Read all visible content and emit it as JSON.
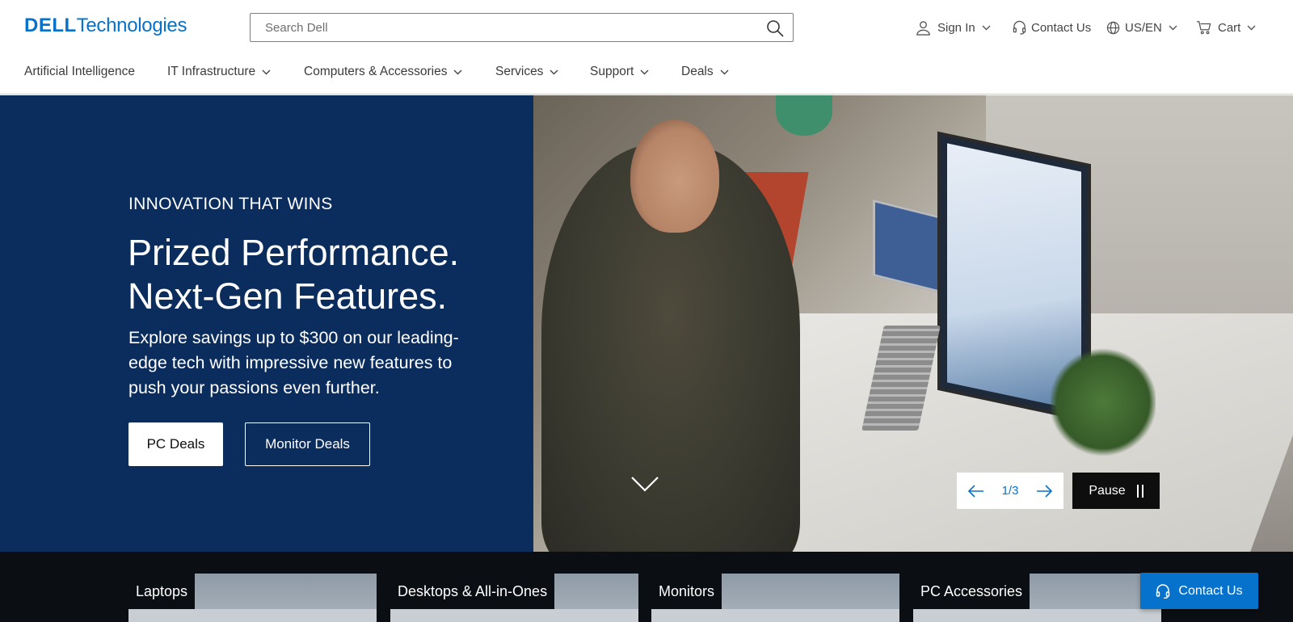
{
  "header": {
    "logo": {
      "brand": "DELL",
      "suffix": "Technologies"
    },
    "search": {
      "placeholder": "Search Dell",
      "value": ""
    },
    "utility": {
      "sign_in": "Sign In",
      "contact": "Contact Us",
      "locale": "US/EN",
      "cart": "Cart"
    },
    "nav": [
      {
        "label": "Artificial Intelligence",
        "has_menu": false
      },
      {
        "label": "IT Infrastructure",
        "has_menu": true
      },
      {
        "label": "Computers & Accessories",
        "has_menu": true
      },
      {
        "label": "Services",
        "has_menu": true
      },
      {
        "label": "Support",
        "has_menu": true
      },
      {
        "label": "Deals",
        "has_menu": true
      }
    ]
  },
  "hero": {
    "eyebrow": "INNOVATION THAT WINS",
    "headline_line1": "Prized Performance.",
    "headline_line2": "Next-Gen Features.",
    "subhead": "Explore savings up to $300 on our leading-edge tech with impressive new features to push your passions even further.",
    "primary_cta": "PC Deals",
    "secondary_cta": "Monitor Deals",
    "carousel": {
      "position": "1/3",
      "pause_label": "Pause"
    },
    "background_color": "#0b2d5e"
  },
  "categories": [
    {
      "label": "Laptops"
    },
    {
      "label": "Desktops & All-in-Ones"
    },
    {
      "label": "Monitors"
    },
    {
      "label": "PC Accessories"
    }
  ],
  "floating_contact": {
    "label": "Contact Us"
  },
  "colors": {
    "accent": "#0672cb",
    "hero_bg": "#0b2d5e",
    "strip_bg": "#0b0e13"
  }
}
